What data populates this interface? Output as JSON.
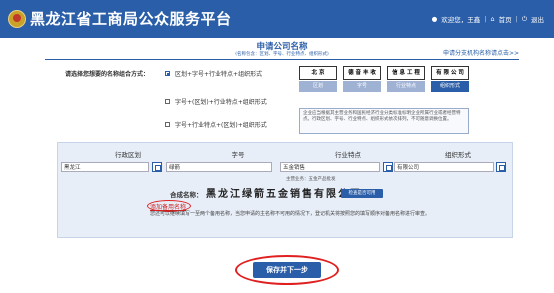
{
  "header": {
    "title": "黑龙江省工商局公众服务平台",
    "user_text": "欢迎您，王鑫",
    "home_label": "首页",
    "logout_label": "退出",
    "separator": "|",
    "bg_color": "#2a5ea8"
  },
  "form": {
    "title": "申请公司名称",
    "subtitle": "(名称包含：区划、字号、行业特点、组织形式)",
    "branch_link": "申请分支机构名称请点击>>",
    "combo_label": "请选择您想要的名称组合方式：",
    "options": [
      {
        "label": "区划+字号+行业特点+组织形式",
        "checked": true
      },
      {
        "label": "字号+(区划)+行业特点+组织形式",
        "checked": false
      },
      {
        "label": "字号+行业特点+(区划)+组织形式",
        "checked": false
      }
    ],
    "examples": [
      {
        "chars": "北 京",
        "label": "区划",
        "active": false
      },
      {
        "chars": "德 音 丰 收",
        "label": "字号",
        "active": false
      },
      {
        "chars": "信 息 工 程",
        "label": "行业特点",
        "active": false
      },
      {
        "chars": "有 限 公 司",
        "label": "组织形式",
        "active": true
      }
    ],
    "note": "企业应当根据其主营业务和国民经济行业分类标准标明企业所属行业或者经营特点。行政区划、字号、行业特点、组织形式依次排列，不可随意调换位置。"
  },
  "fields": {
    "headers": [
      "行政区划",
      "字号",
      "行业特点",
      "组织形式"
    ],
    "values": {
      "region": "黑龙江",
      "brand": "绿箭",
      "industry": "五金销售",
      "org_form": "有限公司"
    },
    "industry_hint": "主营业务：五金产品批发",
    "composed_label": "合成名称：",
    "composed_name": "黑龙江绿箭五金销售有限公司",
    "check_button": "检查是否可用",
    "add_alt": "添加备用名称",
    "alt_note": "您还可以继续填写一至两个备用名称，当您申请的主名称不可用的情况下，登记机关将按照您的填写顺序对备用名称进行审查。"
  },
  "footer": {
    "save_button": "保存并下一步"
  }
}
